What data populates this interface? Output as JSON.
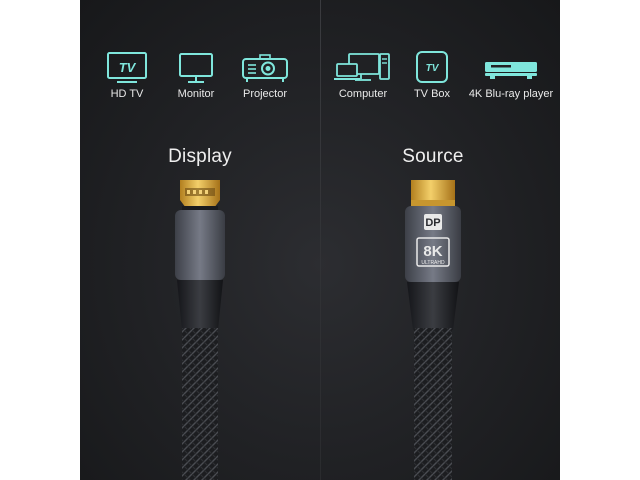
{
  "display": {
    "heading": "Display",
    "devices": [
      {
        "label": "HD TV",
        "icon": "tv-icon"
      },
      {
        "label": "Monitor",
        "icon": "monitor-icon"
      },
      {
        "label": "Projector",
        "icon": "projector-icon"
      }
    ],
    "connector": "hdmi-plug"
  },
  "source": {
    "heading": "Source",
    "devices": [
      {
        "label": "Computer",
        "icon": "computer-icon"
      },
      {
        "label": "TV Box",
        "icon": "tv-box-icon"
      },
      {
        "label": "4K Blu-ray player",
        "icon": "bluray-player-icon"
      }
    ],
    "connector": "displayport-plug",
    "badge_main": "8K",
    "badge_sub": "ULTRAHD",
    "logo_text": "DP"
  },
  "colors": {
    "icon": "#7fe6dc",
    "panel": "#202124",
    "text": "#e9e9e9",
    "gold": "#e9b84a"
  }
}
